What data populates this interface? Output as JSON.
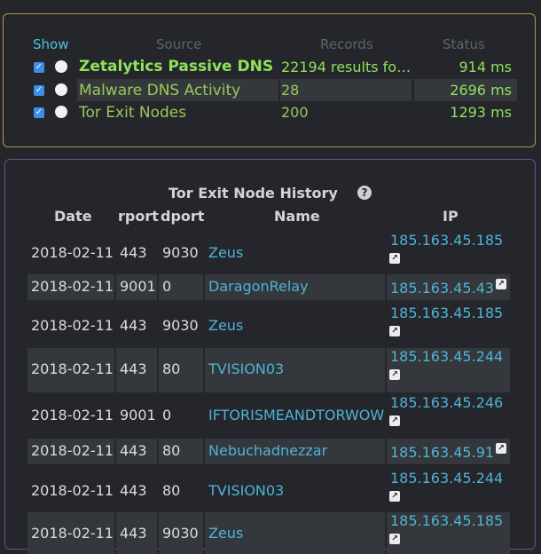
{
  "sources": {
    "headers": {
      "show": "Show",
      "source": "Source",
      "records": "Records",
      "status": "Status"
    },
    "rows": [
      {
        "name": "Zetalytics Passive DNS",
        "records": "22194 results fo…",
        "status": "914 ms"
      },
      {
        "name": "Malware DNS Activity",
        "records": "28",
        "status": "2696 ms"
      },
      {
        "name": "Tor Exit Nodes",
        "records": "200",
        "status": "1293 ms"
      }
    ],
    "checkbox_glyph": "✓"
  },
  "history": {
    "title": "Tor Exit Node History",
    "help_glyph": "?",
    "ext_glyph": "↗",
    "columns": {
      "date": "Date",
      "rport": "rport",
      "dport": "dport",
      "name": "Name",
      "ip": "IP"
    },
    "rows": [
      {
        "date": "2018-02-11",
        "rport": "443",
        "dport": "9030",
        "name": "Zeus",
        "ip": "185.163.45.185"
      },
      {
        "date": "2018-02-11",
        "rport": "9001",
        "dport": "0",
        "name": "DaragonRelay",
        "ip": "185.163.45.43"
      },
      {
        "date": "2018-02-11",
        "rport": "443",
        "dport": "9030",
        "name": "Zeus",
        "ip": "185.163.45.185"
      },
      {
        "date": "2018-02-11",
        "rport": "443",
        "dport": "80",
        "name": "TVISION03",
        "ip": "185.163.45.244"
      },
      {
        "date": "2018-02-11",
        "rport": "9001",
        "dport": "0",
        "name": "IFTORISMEANDTORWOWn",
        "ip": "185.163.45.246"
      },
      {
        "date": "2018-02-11",
        "rport": "443",
        "dport": "80",
        "name": "Nebuchadnezzar",
        "ip": "185.163.45.91"
      },
      {
        "date": "2018-02-11",
        "rport": "443",
        "dport": "80",
        "name": "TVISION03",
        "ip": "185.163.45.244"
      },
      {
        "date": "2018-02-11",
        "rport": "443",
        "dport": "9030",
        "name": "Zeus",
        "ip": "185.163.45.185"
      }
    ]
  }
}
